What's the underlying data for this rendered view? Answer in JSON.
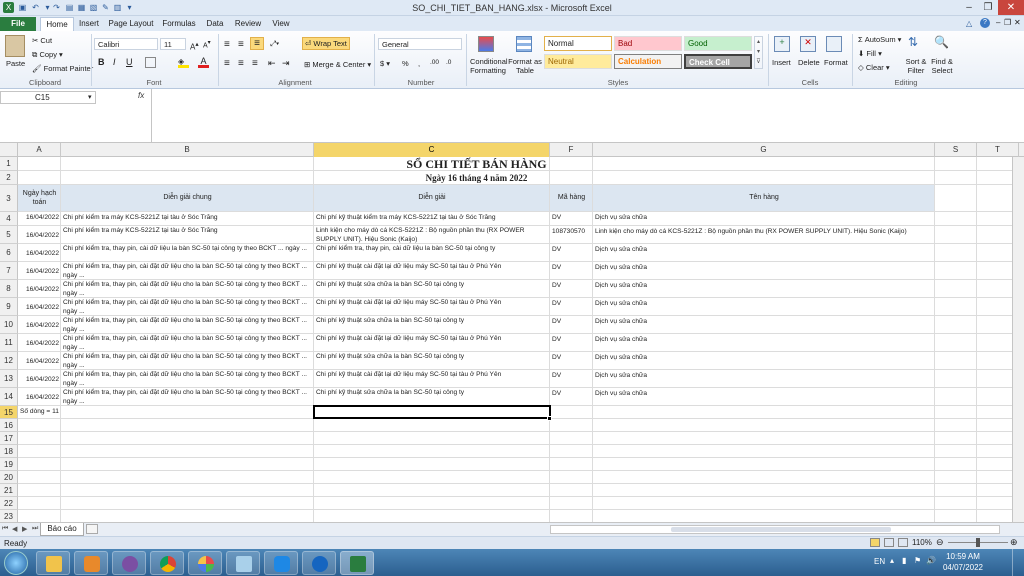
{
  "window": {
    "title": "SO_CHI_TIET_BAN_HANG.xlsx - Microsoft Excel"
  },
  "ribbon_tabs": [
    "File",
    "Home",
    "Insert",
    "Page Layout",
    "Formulas",
    "Data",
    "Review",
    "View"
  ],
  "ribbon": {
    "clipboard": {
      "paste": "Paste",
      "cut": "Cut",
      "copy": "Copy",
      "format_painter": "Format Painter",
      "label": "Clipboard"
    },
    "font": {
      "name": "Calibri",
      "size": "11",
      "label": "Font"
    },
    "alignment": {
      "wrap": "Wrap Text",
      "merge": "Merge & Center",
      "label": "Alignment"
    },
    "number": {
      "format": "General",
      "label": "Number"
    },
    "styles": {
      "cond_format": "Conditional Formatting",
      "format_table": "Format as Table",
      "normal": "Normal",
      "bad": "Bad",
      "good": "Good",
      "neutral": "Neutral",
      "calculation": "Calculation",
      "check_cell": "Check Cell",
      "label": "Styles"
    },
    "cells": {
      "insert": "Insert",
      "delete": "Delete",
      "format": "Format",
      "label": "Cells"
    },
    "editing": {
      "autosum": "AutoSum",
      "fill": "Fill",
      "clear": "Clear",
      "sort": "Sort & Filter",
      "find": "Find & Select",
      "label": "Editing"
    }
  },
  "formula_bar": {
    "name_box": "C15",
    "fx": "fx",
    "value": ""
  },
  "columns": [
    "A",
    "B",
    "C",
    "F",
    "G",
    "S",
    "T"
  ],
  "sheet": {
    "title": "SỔ CHI TIẾT BÁN HÀNG",
    "subtitle": "Ngày 16 tháng 4 năm 2022",
    "headers": {
      "a": "Ngày hạch toán",
      "b": "Diễn giải chung",
      "c": "Diễn giải",
      "f": "Mã hàng",
      "g": "Tên hàng"
    },
    "rows": [
      {
        "num": "4",
        "a": "16/04/2022",
        "b": "Chi phí kiểm tra máy KCS-5221Z tại tàu ở Sóc Trăng",
        "c": "Chi phí kỹ thuật kiểm tra máy KCS-5221Z tại tàu ở Sóc Trăng",
        "f": "DV",
        "g": "Dịch vụ sửa chữa"
      },
      {
        "num": "5",
        "a": "16/04/2022",
        "b": "Chi phí kiểm tra máy KCS-5221Z tại tàu ở Sóc Trăng",
        "c": "Linh kiện cho máy dò cá KCS-5221Z : Bộ nguồn phần thu (RX POWER SUPPLY UNIT). Hiệu Sonic (Kaijo)",
        "f": "108730570",
        "g": "Linh kiện cho máy dò cá KCS-5221Z : Bộ nguồn phần thu (RX POWER SUPPLY UNIT). Hiệu Sonic (Kaijo)"
      },
      {
        "num": "6",
        "a": "16/04/2022",
        "b": "Chi phí kiểm tra, thay pin, cài dữ liệu la bàn SC-50 tại công ty theo BCKT ... ngày ...",
        "c": "Chi phí kiểm tra, thay pin, cài dữ liệu la bàn SC-50 tại công ty",
        "f": "DV",
        "g": "Dịch vụ sửa chữa"
      },
      {
        "num": "7",
        "a": "16/04/2022",
        "b": "Chi phí kiểm tra, thay pin, cài đặt dữ liệu cho la bàn SC-50 tại công ty theo BCKT ... ngày ...",
        "c": "Chi phí kỹ thuật cài đặt lại dữ liệu máy SC-50 tại tàu ở Phú Yên",
        "f": "DV",
        "g": "Dịch vụ sửa chữa"
      },
      {
        "num": "8",
        "a": "16/04/2022",
        "b": "Chi phí kiểm tra, thay pin, cài đặt dữ liệu cho la bàn SC-50 tại công ty theo BCKT ... ngày ...",
        "c": "Chi phí kỹ thuật sửa chữa la bàn SC-50 tại công ty",
        "f": "DV",
        "g": "Dịch vụ sửa chữa"
      },
      {
        "num": "9",
        "a": "16/04/2022",
        "b": "Chi phí kiểm tra, thay pin, cài đặt dữ liệu cho la bàn SC-50 tại công ty theo BCKT ... ngày ...",
        "c": "Chi phí kỹ thuật cài đặt lại dữ liệu máy SC-50 tại tàu ở Phú Yên",
        "f": "DV",
        "g": "Dịch vụ sửa chữa"
      },
      {
        "num": "10",
        "a": "16/04/2022",
        "b": "Chi phí kiểm tra, thay pin, cài đặt dữ liệu cho la bàn SC-50 tại công ty theo BCKT ... ngày ...",
        "c": "Chi phí kỹ thuật sửa chữa la bàn SC-50 tại công ty",
        "f": "DV",
        "g": "Dịch vụ sửa chữa"
      },
      {
        "num": "11",
        "a": "16/04/2022",
        "b": "Chi phí kiểm tra, thay pin, cài đặt dữ liệu cho la bàn SC-50 tại công ty theo BCKT ... ngày ...",
        "c": "Chi phí kỹ thuật cài đặt lại dữ liệu máy SC-50 tại tàu ở Phú Yên",
        "f": "DV",
        "g": "Dịch vụ sửa chữa"
      },
      {
        "num": "12",
        "a": "16/04/2022",
        "b": "Chi phí kiểm tra, thay pin, cài đặt dữ liệu cho la bàn SC-50 tại công ty theo BCKT ... ngày ...",
        "c": "Chi phí kỹ thuật sửa chữa la bàn SC-50 tại công ty",
        "f": "DV",
        "g": "Dịch vụ sửa chữa"
      },
      {
        "num": "13",
        "a": "16/04/2022",
        "b": "Chi phí kiểm tra, thay pin, cài đặt dữ liệu cho la bàn SC-50 tại công ty theo BCKT ... ngày ...",
        "c": "Chi phí kỹ thuật cài đặt lại dữ liệu máy SC-50 tại tàu ở Phú Yên",
        "f": "DV",
        "g": "Dịch vụ sửa chữa"
      },
      {
        "num": "14",
        "a": "16/04/2022",
        "b": "Chi phí kiểm tra, thay pin, cài đặt dữ liệu cho la bàn SC-50 tại công ty theo BCKT ... ngày ...",
        "c": "Chi phí kỹ thuật sửa chữa la bàn SC-50 tại công ty",
        "f": "DV",
        "g": "Dịch vụ sửa chữa"
      }
    ],
    "row15_a": "Số dòng = 11",
    "empty_rows": [
      "16",
      "17",
      "18",
      "19",
      "20",
      "21",
      "22",
      "23"
    ]
  },
  "row_labels": {
    "r1": "1",
    "r2": "2",
    "r3": "3",
    "r15": "15"
  },
  "sheet_tab": "Báo cáo",
  "status": {
    "ready": "Ready",
    "zoom": "110%"
  },
  "taskbar": {
    "lang": "EN",
    "time": "10:59 AM",
    "date": "04/07/2022"
  },
  "colors": {
    "header_fill": "#dce6f1",
    "selected_header": "#f4d56a",
    "excel_green": "#2a7d3f"
  }
}
